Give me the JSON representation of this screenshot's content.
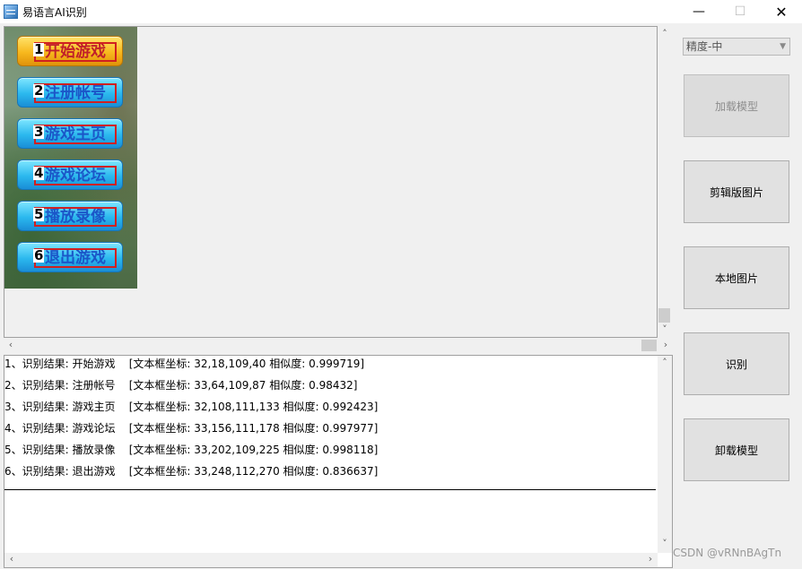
{
  "window": {
    "title": "易语言AI识别"
  },
  "image_panel": {
    "buttons": [
      {
        "num": "1",
        "label": "开始游戏",
        "style": "gold"
      },
      {
        "num": "2",
        "label": "注册帐号",
        "style": "blue"
      },
      {
        "num": "3",
        "label": "游戏主页",
        "style": "blue"
      },
      {
        "num": "4",
        "label": "游戏论坛",
        "style": "blue"
      },
      {
        "num": "5",
        "label": "播放录像",
        "style": "blue"
      },
      {
        "num": "6",
        "label": "退出游戏",
        "style": "blue"
      }
    ]
  },
  "results": [
    "1、识别结果: 开始游戏    [文本框坐标: 32,18,109,40 相似度: 0.999719]",
    "2、识别结果: 注册帐号    [文本框坐标: 33,64,109,87 相似度: 0.98432]",
    "3、识别结果: 游戏主页    [文本框坐标: 32,108,111,133 相似度: 0.992423]",
    "4、识别结果: 游戏论坛    [文本框坐标: 33,156,111,178 相似度: 0.997977]",
    "5、识别结果: 播放录像    [文本框坐标: 33,202,109,225 相似度: 0.998118]",
    "6、识别结果: 退出游戏    [文本框坐标: 33,248,112,270 相似度: 0.836637]"
  ],
  "sidebar": {
    "precision": "精度-中",
    "buttons": {
      "load_model": "加载模型",
      "clipboard_image": "剪辑版图片",
      "local_image": "本地图片",
      "recognize": "识别",
      "unload_model": "卸载模型"
    }
  },
  "watermark": "CSDN @vRNnBAgTn"
}
